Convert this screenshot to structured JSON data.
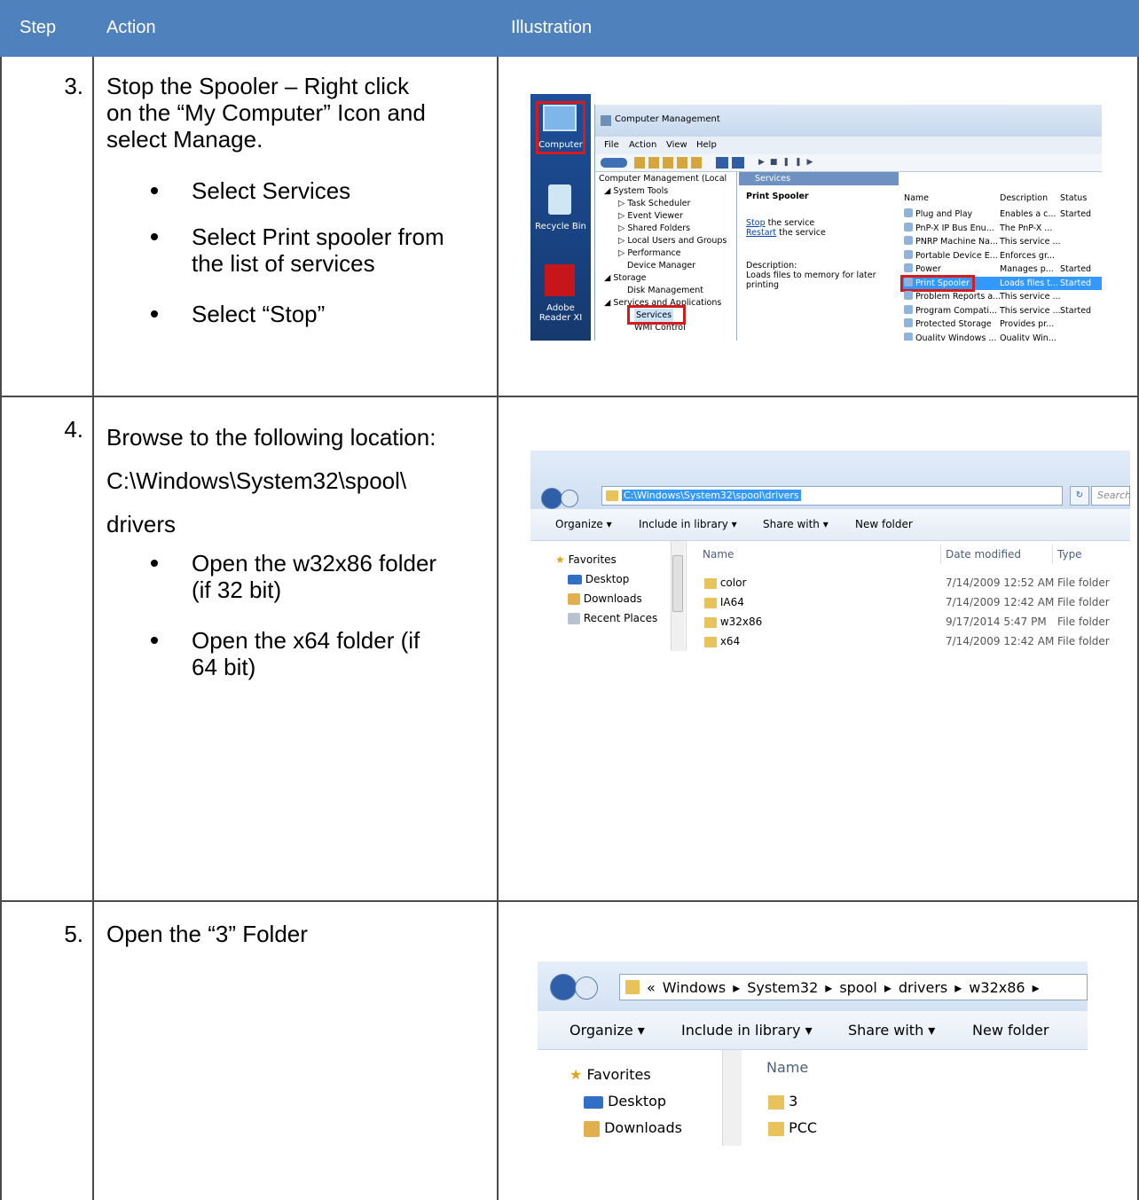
{
  "header": {
    "step": "Step",
    "action": "Action",
    "illustration": "Illustration"
  },
  "rows": [
    {
      "num": "3.",
      "lines": [
        "Stop the Spooler – Right click",
        "on the “My Computer” Icon and",
        "select Manage."
      ],
      "bullets": [
        "Select Services",
        "Select Print spooler from",
        "the list of services",
        "Select “Stop”"
      ]
    },
    {
      "num": "4.",
      "lines": [
        "Browse to the following location:",
        "C:\\Windows\\System32\\spool\\",
        "drivers"
      ],
      "bullets": [
        "Open the w32x86 folder",
        "(if 32 bit)",
        "Open the x64 folder (if",
        "64 bit)"
      ]
    },
    {
      "num": "5.",
      "lines": [
        "Open the “3” Folder"
      ],
      "bullets": []
    }
  ],
  "shot1": {
    "desktop": [
      "Computer",
      "Recycle Bin",
      "Adobe",
      "Reader XI"
    ],
    "title": "Computer Management",
    "menu": [
      "File",
      "Action",
      "View",
      "Help"
    ],
    "tree": [
      "Computer Management (Local",
      "System Tools",
      "Task Scheduler",
      "Event Viewer",
      "Shared Folders",
      "Local Users and Groups",
      "Performance",
      "Device Manager",
      "Storage",
      "Disk Management",
      "Services and Applications",
      "Services",
      "WMI Control"
    ],
    "tab": "Services",
    "panel_title": "Print Spooler",
    "stop_link": "Stop",
    "stop_rest": " the service",
    "restart_link": "Restart",
    "restart_rest": " the service",
    "desc_label": "Description:",
    "desc_text": [
      "Loads files to memory for later",
      "printing"
    ],
    "cols": [
      "Name",
      "Description",
      "Status"
    ],
    "services": [
      [
        "Plug and Play",
        "Enables a c...",
        "Started"
      ],
      [
        "PnP-X IP Bus Enu...",
        "The PnP-X ...",
        ""
      ],
      [
        "PNRP Machine Na...",
        "This service ...",
        ""
      ],
      [
        "Portable Device E...",
        "Enforces gr...",
        ""
      ],
      [
        "Power",
        "Manages p...",
        "Started"
      ],
      [
        "Print Spooler",
        "Loads files t...",
        "Started"
      ],
      [
        "Problem Reports a...",
        "This service ...",
        ""
      ],
      [
        "Program Compati...",
        "This service ...",
        "Started"
      ],
      [
        "Protected Storage",
        "Provides pr...",
        ""
      ],
      [
        "Quality Windows ...",
        "Quality Win...",
        ""
      ]
    ]
  },
  "shot2": {
    "path": "C:\\Windows\\System32\\spool\\drivers",
    "search": "Search",
    "cmd": [
      "Organize ▾",
      "Include in library ▾",
      "Share with ▾",
      "New folder"
    ],
    "nav": [
      "Favorites",
      "Desktop",
      "Downloads",
      "Recent Places"
    ],
    "cols": [
      "Name",
      "Date modified",
      "Type"
    ],
    "files": [
      [
        "color",
        "7/14/2009 12:52 AM",
        "File folder"
      ],
      [
        "IA64",
        "7/14/2009 12:42 AM",
        "File folder"
      ],
      [
        "w32x86",
        "9/17/2014 5:47 PM",
        "File folder"
      ],
      [
        "x64",
        "7/14/2009 12:42 AM",
        "File folder"
      ]
    ]
  },
  "shot3": {
    "crumbs": [
      "«",
      "Windows",
      "▸",
      "System32",
      "▸",
      "spool",
      "▸",
      "drivers",
      "▸",
      "w32x86",
      "▸"
    ],
    "cmd": [
      "Organize ▾",
      "Include in library ▾",
      "Share with ▾",
      "New folder"
    ],
    "nav": [
      "Favorites",
      "Desktop",
      "Downloads"
    ],
    "col": "Name",
    "files": [
      "3",
      "PCC"
    ]
  },
  "colors": {
    "header_bg": "#4f81bd",
    "highlight_red": "#d81a1a",
    "selection_blue": "#3399ff"
  }
}
